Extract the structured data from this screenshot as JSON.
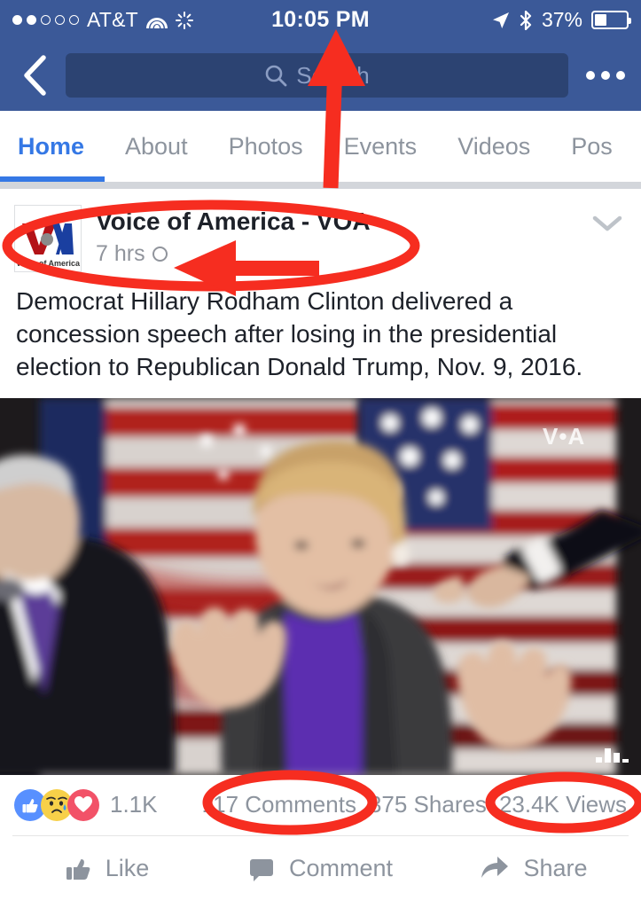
{
  "status_bar": {
    "carrier": "AT&T",
    "signal_dots_total": 5,
    "signal_dots_filled": 2,
    "wifi_icon": "wifi-icon",
    "activity_icon": "activity-spinner-icon",
    "time": "10:05 PM",
    "location_icon": "location-arrow-icon",
    "bluetooth_icon": "bluetooth-icon",
    "battery_percent": "37%",
    "battery_level": 37
  },
  "nav_bar": {
    "back_icon": "back-chevron-icon",
    "search_icon": "search-icon",
    "search_value": "",
    "search_placeholder": "Search",
    "more_icon": "more-dots-icon"
  },
  "tabs": [
    {
      "label": "Home",
      "active": true
    },
    {
      "label": "About",
      "active": false
    },
    {
      "label": "Photos",
      "active": false
    },
    {
      "label": "Events",
      "active": false
    },
    {
      "label": "Videos",
      "active": false
    },
    {
      "label": "Pos",
      "active": false
    }
  ],
  "post": {
    "avatar_logo_letters": "V•A",
    "avatar_logo_caption": "Voice of America",
    "page_name": "Voice of America - VOA",
    "timestamp": "7 hrs",
    "privacy_icon": "globe-icon",
    "options_icon": "chevron-down-icon",
    "text": "Democrat Hillary Rodham Clinton delivered a concession speech after losing in the presidential election to Republican Donald Trump, Nov. 9, 2016.",
    "video_watermark": "V•A",
    "video_quality_icon": "video-bars-icon"
  },
  "engagement": {
    "reactions": [
      {
        "name": "like-reaction-icon",
        "color": "#5890ff"
      },
      {
        "name": "sad-reaction-icon",
        "color": "#f7d049"
      },
      {
        "name": "love-reaction-icon",
        "color": "#f25268"
      }
    ],
    "reaction_count": "1.1K",
    "comments": "117 Comments",
    "shares": "375 Shares",
    "views": "23.4K Views"
  },
  "actions": [
    {
      "label": "Like",
      "icon": "thumbs-up-icon"
    },
    {
      "label": "Comment",
      "icon": "comment-bubble-icon"
    },
    {
      "label": "Share",
      "icon": "share-arrow-icon"
    }
  ],
  "annotations": {
    "color": "#f62d20",
    "items": [
      {
        "type": "arrow",
        "name": "annotation-arrow-clock",
        "target": "status-bar-time"
      },
      {
        "type": "ellipse",
        "name": "annotation-ellipse-page-header",
        "target": "post-header"
      },
      {
        "type": "arrow",
        "name": "annotation-arrow-timestamp",
        "target": "post-timestamp"
      },
      {
        "type": "ellipse",
        "name": "annotation-ellipse-comments",
        "target": "comments-stat"
      },
      {
        "type": "ellipse",
        "name": "annotation-ellipse-views",
        "target": "views-stat"
      }
    ]
  },
  "theme": {
    "brand_blue": "#3b5998",
    "accent_blue": "#3578e5",
    "muted_gray": "#8d949e"
  }
}
